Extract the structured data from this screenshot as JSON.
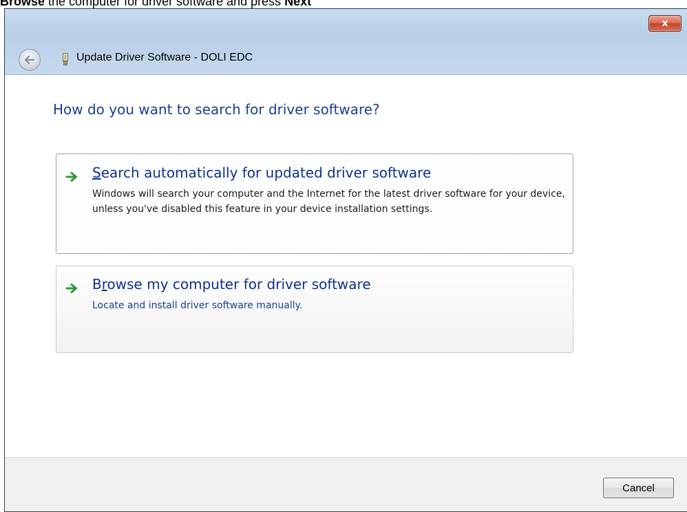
{
  "caption": {
    "browse": "Browse",
    "mid": " the computer for driver software and press ",
    "next": "Next"
  },
  "window": {
    "title": "Update Driver Software - DOLI EDC",
    "close_label": "x",
    "back_icon": "back-arrow-icon",
    "device_icon": "usb-device-icon"
  },
  "content": {
    "heading": "How do you want to search for driver software?",
    "options": [
      {
        "title_accel": "S",
        "title_rest": "earch automatically for updated driver software",
        "description": "Windows will search your computer and the Internet for the latest driver software for your device, unless you've disabled this feature in your device installation settings.",
        "icon": "green-arrow-icon"
      },
      {
        "title_pre": "B",
        "title_accel": "r",
        "title_rest": "owse my computer for driver software",
        "description": "Locate and install driver software manually.",
        "icon": "green-arrow-icon"
      }
    ]
  },
  "footer": {
    "cancel_label": "Cancel"
  },
  "colors": {
    "heading": "#1a3f92",
    "link_title": "#10318c",
    "arrow_green": "#2e9b2e",
    "close_red": "#c4432a"
  }
}
